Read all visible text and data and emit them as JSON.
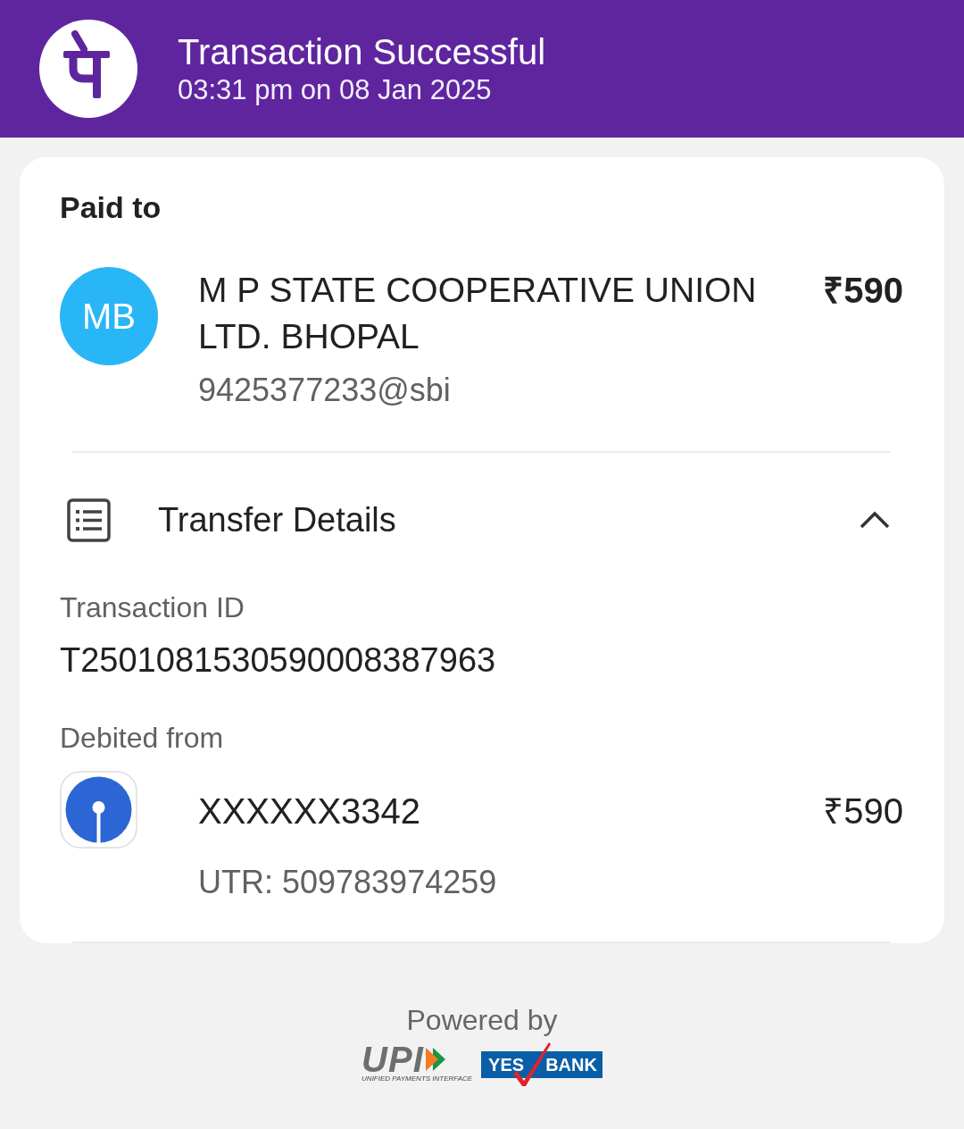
{
  "header": {
    "title": "Transaction Successful",
    "subtitle": "03:31 pm on 08 Jan 2025"
  },
  "paid_to": {
    "heading": "Paid to",
    "avatar": "MB",
    "name": "M P STATE COOPERATIVE UNION LTD. BHOPAL",
    "amount": "₹590",
    "upi_id": "9425377233@sbi"
  },
  "transfer_details": {
    "title": "Transfer Details",
    "expanded": true,
    "transaction_id": {
      "label": "Transaction ID",
      "value": "T2501081530590008387963"
    },
    "debited_from": {
      "label": "Debited from",
      "account": "XXXXXX3342",
      "amount": "₹590",
      "utr": "UTR: 509783974259"
    }
  },
  "footer": {
    "text": "Powered by",
    "logos": [
      {
        "kind": "upi",
        "name": "UPI",
        "tagline": "UNIFIED PAYMENTS INTERFACE"
      },
      {
        "kind": "bank",
        "words": [
          "YES",
          "BANK"
        ]
      }
    ]
  }
}
